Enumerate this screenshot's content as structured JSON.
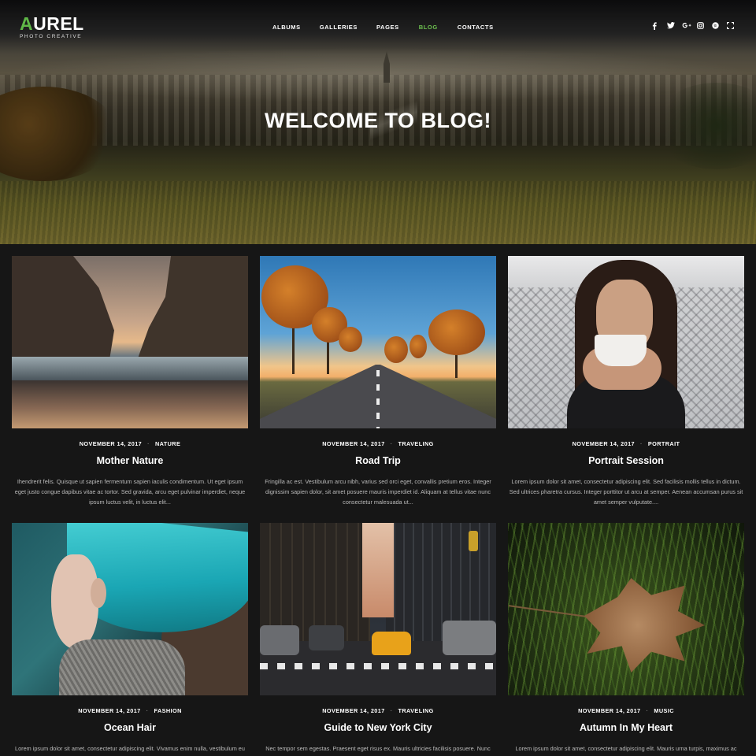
{
  "brand": {
    "logo_first": "A",
    "logo_rest": "UREL",
    "tagline": "PHOTO CREATIVE"
  },
  "nav": {
    "items": [
      {
        "label": "ALBUMS",
        "active": false
      },
      {
        "label": "GALLERIES",
        "active": false
      },
      {
        "label": "PAGES",
        "active": false
      },
      {
        "label": "BLOG",
        "active": true
      },
      {
        "label": "CONTACTS",
        "active": false
      }
    ]
  },
  "social": [
    "facebook-icon",
    "twitter-icon",
    "google-plus-icon",
    "instagram-icon",
    "pinterest-icon",
    "fullscreen-icon"
  ],
  "hero": {
    "title": "WELCOME TO BLOG!"
  },
  "colors": {
    "accent": "#6cbf4e",
    "background": "#161616"
  },
  "posts": [
    {
      "date": "NOVEMBER 14, 2017",
      "category": "NATURE",
      "title": "Mother Nature",
      "excerpt": "Ihendrerit felis. Quisque ut sapien fermentum sapien iaculis condimentum. Ut eget ipsum eget justo congue dapibus vitae ac tortor. Sed gravida, arcu eget pulvinar imperdiet, neque ipsum luctus velit, in luctus elit..."
    },
    {
      "date": "NOVEMBER 14, 2017",
      "category": "TRAVELING",
      "title": "Road Trip",
      "excerpt": "Fringilla ac est. Vestibulum arcu nibh, varius sed orci eget, convallis pretium eros. Integer dignissim sapien dolor, sit amet posuere mauris imperdiet id. Aliquam at tellus vitae nunc consectetur malesuada ut..."
    },
    {
      "date": "NOVEMBER 14, 2017",
      "category": "PORTRAIT",
      "title": "Portrait Session",
      "excerpt": "Lorem ipsum dolor sit amet, consectetur adipiscing elit. Sed facilisis mollis tellus in dictum. Sed ultrices pharetra cursus. Integer porttitor ut arcu at semper. Aenean accumsan purus sit amet semper vulputate...."
    },
    {
      "date": "NOVEMBER 14, 2017",
      "category": "FASHION",
      "title": "Ocean Hair",
      "excerpt": "Lorem ipsum dolor sit amet, consectetur adipiscing elit. Vivamus enim nulla, vestibulum eu sollicitudin eget, commodo eget ipsum. Duis at sapien in eros ultrices"
    },
    {
      "date": "NOVEMBER 14, 2017",
      "category": "TRAVELING",
      "title": "Guide to New York City",
      "excerpt": "Nec tempor sem egestas. Praesent eget risus ex. Mauris ultricies facilisis posuere. Nunc ligula ante, pulvinar eget consequat et, posuere id orci. Phasellus vel vulputate"
    },
    {
      "date": "NOVEMBER 14, 2017",
      "category": "MUSIC",
      "title": "Autumn In My Heart",
      "excerpt": "Lorem ipsum dolor sit amet, consectetur adipiscing elit. Mauris urna turpis, maximus ac ultrices id, commodo non magna. Aenean vel dignissim urna. Nullam consequat"
    }
  ]
}
